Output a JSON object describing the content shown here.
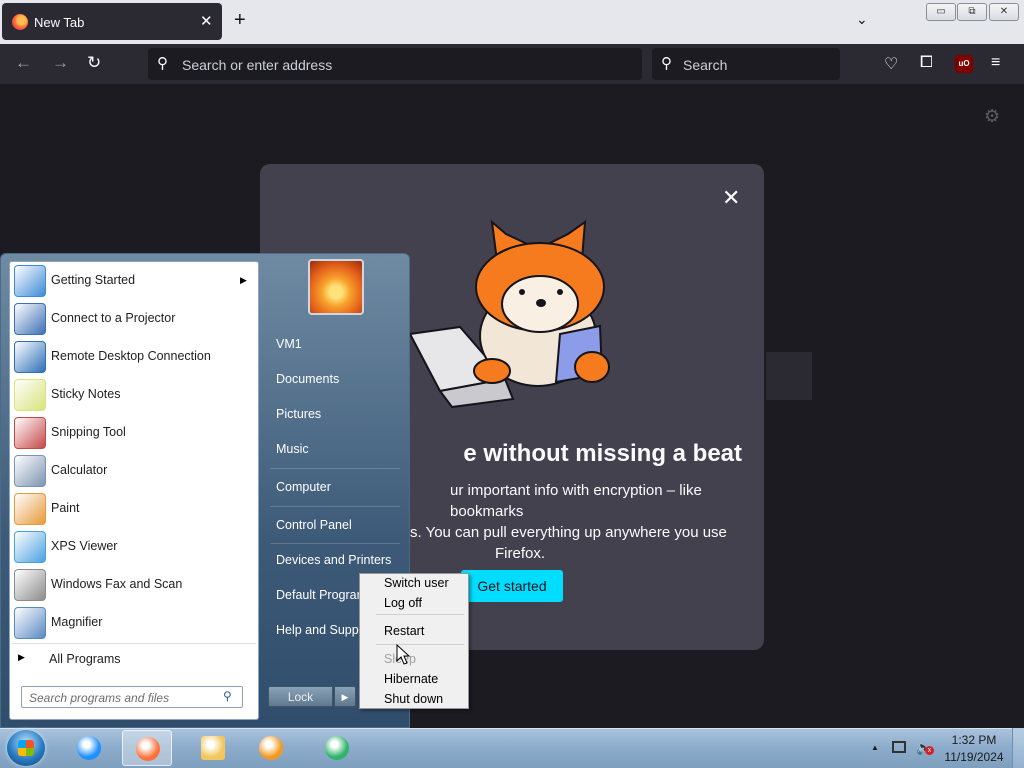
{
  "browser": {
    "tab_title": "New Tab",
    "tab_close": "✕",
    "new_tab": "+",
    "list_all_tabs": "⌄",
    "url_placeholder": "Search or enter address",
    "search_placeholder": "Search",
    "ublock_label": "uO",
    "window_controls": {
      "minimize": "▭",
      "restore": "⧉",
      "close": "✕"
    }
  },
  "newtab_modal": {
    "heading": "Sync without missing a beat",
    "heading_visible": "e without missing a beat",
    "body": "ur important info with encryption – like bookmarks",
    "body_line2": "s. You can pull everything up anywhere you use",
    "body_line3": "Firefox.",
    "cta": "Get started",
    "close": "✕"
  },
  "start_menu": {
    "programs": [
      {
        "label": "Getting Started",
        "icon": "getting-started-icon",
        "color": "#3d8bd6",
        "has_submenu": true
      },
      {
        "label": "Connect to a Projector",
        "icon": "projector-icon",
        "color": "#3c6fb5"
      },
      {
        "label": "Remote Desktop Connection",
        "icon": "remote-desktop-icon",
        "color": "#2d6fb8"
      },
      {
        "label": "Sticky Notes",
        "icon": "sticky-notes-icon",
        "color": "#d8e37a"
      },
      {
        "label": "Snipping Tool",
        "icon": "snipping-tool-icon",
        "color": "#c54848"
      },
      {
        "label": "Calculator",
        "icon": "calculator-icon",
        "color": "#7c93b1"
      },
      {
        "label": "Paint",
        "icon": "paint-icon",
        "color": "#e69a3a"
      },
      {
        "label": "XPS Viewer",
        "icon": "xps-viewer-icon",
        "color": "#4aa1e0"
      },
      {
        "label": "Windows Fax and Scan",
        "icon": "fax-scan-icon",
        "color": "#8c8c8c"
      },
      {
        "label": "Magnifier",
        "icon": "magnifier-icon",
        "color": "#5a88c2"
      }
    ],
    "all_programs": "All Programs",
    "search_placeholder": "Search programs and files",
    "places": [
      "VM1",
      "Documents",
      "Pictures",
      "Music",
      "Computer",
      "Control Panel",
      "Devices and Printers",
      "Default Programs",
      "Help and Support"
    ],
    "lock_button": "Lock",
    "power_arrow": "▶"
  },
  "power_menu": {
    "items": [
      "Switch user",
      "Log off",
      "Restart",
      "Sleep",
      "Hibernate",
      "Shut down"
    ]
  },
  "taskbar": {
    "pinned": [
      {
        "name": "internet-explorer-icon",
        "color": "#1e90ff"
      },
      {
        "name": "firefox-icon",
        "color": "#ff7139"
      },
      {
        "name": "file-explorer-icon",
        "color": "#f3c75d"
      },
      {
        "name": "media-player-icon",
        "color": "#f29a1f"
      },
      {
        "name": "app-icon",
        "color": "#2db36a"
      }
    ],
    "time": "1:32 PM",
    "date": "11/19/2024",
    "tray_arrow": "▲"
  }
}
